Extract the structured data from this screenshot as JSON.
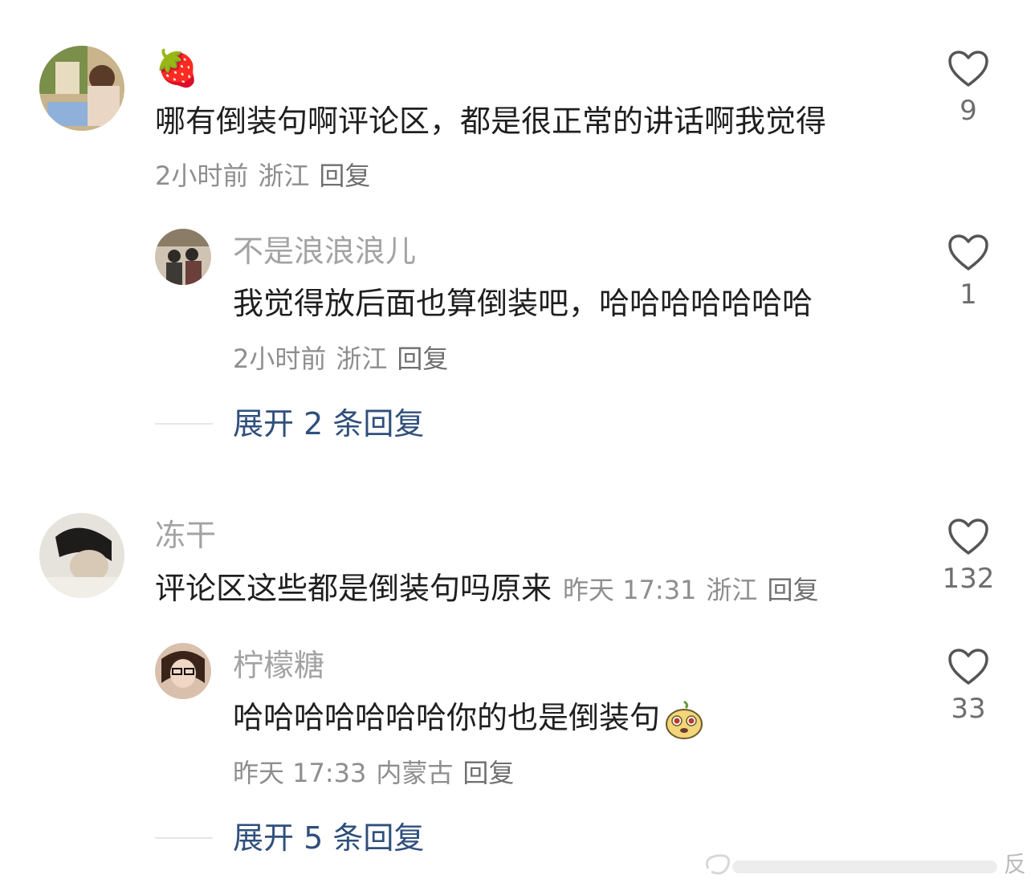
{
  "colors": {
    "name_gray": "#a3a3a3",
    "text_dark": "#1f1f1f",
    "meta_gray": "#8e8e8e",
    "link_blue": "#2f4f7c"
  },
  "comments": [
    {
      "name": "🍓",
      "text": "哪有倒装句啊评论区，都是很正常的讲话啊我觉得",
      "time": "2小时前",
      "location": "浙江",
      "reply": "回复",
      "likes": "9",
      "icon": "heart-icon"
    },
    {
      "name": "不是浪浪浪儿",
      "text": "我觉得放后面也算倒装吧，哈哈哈哈哈哈哈",
      "time": "2小时前",
      "location": "浙江",
      "reply": "回复",
      "likes": "1",
      "icon": "heart-icon"
    },
    {
      "name": "冻干",
      "text": "评论区这些都是倒装句吗原来",
      "time": "昨天 17:31",
      "location": "浙江",
      "reply": "回复",
      "likes": "132",
      "icon": "heart-icon"
    },
    {
      "name": "柠檬糖",
      "text": "哈哈哈哈哈哈哈你的也是倒装句",
      "time": "昨天 17:33",
      "location": "内蒙古",
      "reply": "回复",
      "likes": "33",
      "icon": "heart-icon"
    }
  ],
  "expand": [
    {
      "label": "展开 2 条回复"
    },
    {
      "label": "展开 5 条回复"
    }
  ],
  "watermark": {
    "char": "反"
  }
}
